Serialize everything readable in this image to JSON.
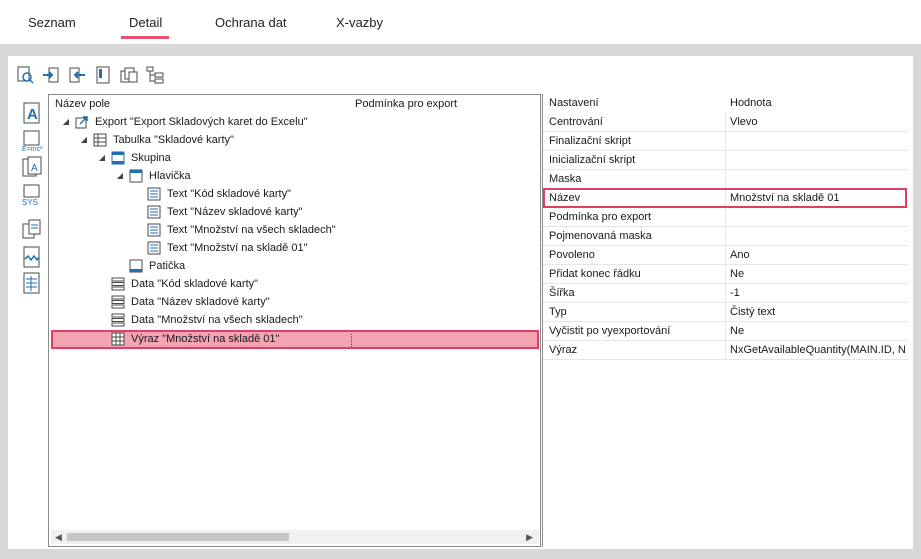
{
  "tabs": [
    {
      "label": "Seznam"
    },
    {
      "label": "Detail"
    },
    {
      "label": "Ochrana dat"
    },
    {
      "label": "X-vazby"
    }
  ],
  "toolbar": {
    "icons": [
      "find-icon",
      "import-icon",
      "export-icon",
      "properties-icon",
      "copy-icon",
      "tree-icon"
    ]
  },
  "left_icons": [
    "label-icon",
    "expression-icon",
    "field-icon",
    "system-icon",
    "copy-pages-icon",
    "wave-icon",
    "table-doc-icon"
  ],
  "tree": {
    "col_name": "Název pole",
    "col_condition": "Podmínka pro export",
    "items": [
      {
        "label": "Export \"Export Skladových karet do Excelu\""
      },
      {
        "label": "Tabulka \"Skladové karty\""
      },
      {
        "label": "Skupina"
      },
      {
        "label": "Hlavička"
      },
      {
        "label": "Text \"Kód skladové karty\""
      },
      {
        "label": "Text \"Název skladové karty\""
      },
      {
        "label": "Text \"Množství na všech skladech\""
      },
      {
        "label": "Text \"Množství na skladě 01\""
      },
      {
        "label": "Patička"
      },
      {
        "label": "Data \"Kód skladové karty\""
      },
      {
        "label": "Data \"Název skladové karty\""
      },
      {
        "label": "Data \"Množství na všech skladech\""
      },
      {
        "label": "Výraz \"Množství na skladě 01\""
      }
    ]
  },
  "properties": {
    "col_setting": "Nastavení",
    "col_value": "Hodnota",
    "rows": [
      {
        "key": "Centrování",
        "value": "Vlevo"
      },
      {
        "key": "Finalizační skript",
        "value": ""
      },
      {
        "key": "Inicializační skript",
        "value": ""
      },
      {
        "key": "Maska",
        "value": ""
      },
      {
        "key": "Název",
        "value": "Množství na skladě 01"
      },
      {
        "key": "Podmínka pro export",
        "value": ""
      },
      {
        "key": "Pojmenovaná maska",
        "value": ""
      },
      {
        "key": "Povoleno",
        "value": "Ano"
      },
      {
        "key": "Přidat konec řádku",
        "value": "Ne"
      },
      {
        "key": "Šířka",
        "value": "-1"
      },
      {
        "key": "Typ",
        "value": "Čistý text"
      },
      {
        "key": "Vyčistit po vyexportování",
        "value": "Ne"
      },
      {
        "key": "Výraz",
        "value": "NxGetAvailableQuantity(MAIN.ID, Nx"
      }
    ]
  },
  "colors": {
    "accent": "#e8516f",
    "selection": "#f4a3b3",
    "background": "#d8d8d8"
  }
}
